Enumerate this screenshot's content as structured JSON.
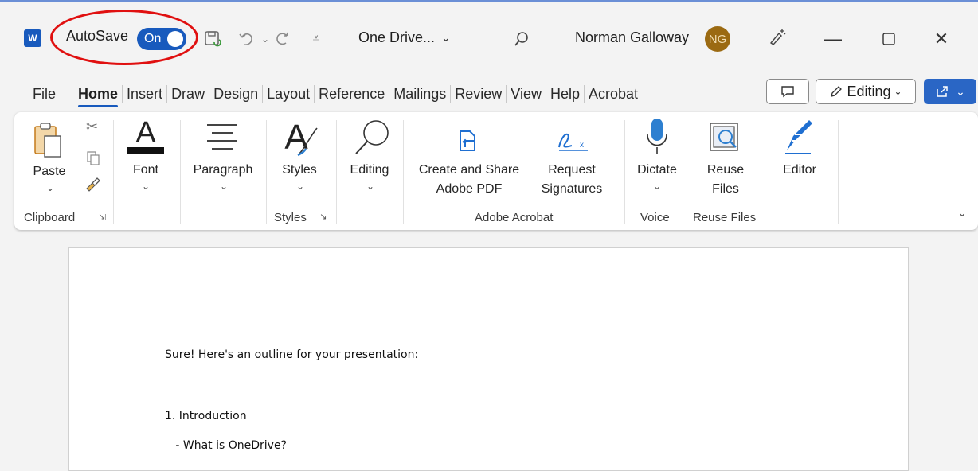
{
  "titlebar": {
    "app_icon_letter": "W",
    "autosave_label": "AutoSave",
    "autosave_state": "On",
    "file_location": "One Drive...",
    "user_name": "Norman Galloway",
    "user_initials": "NG"
  },
  "tabs": [
    "File",
    "Home",
    "Insert",
    "Draw",
    "Design",
    "Layout",
    "Reference",
    "Mailings",
    "Review",
    "View",
    "Help",
    "Acrobat"
  ],
  "active_tab": "Home",
  "mode_button_label": "Editing",
  "ribbon": {
    "paste": "Paste",
    "font": "Font",
    "paragraph": "Paragraph",
    "styles": "Styles",
    "editing": "Editing",
    "create_share_line1": "Create and Share",
    "create_share_line2": "Adobe PDF",
    "request_line1": "Request",
    "request_line2": "Signatures",
    "dictate": "Dictate",
    "reuse_line1": "Reuse",
    "reuse_line2": "Files",
    "editor": "Editor",
    "groups": {
      "clipboard": "Clipboard",
      "styles": "Styles",
      "adobe_acrobat": "Adobe Acrobat",
      "voice": "Voice",
      "reuse_files": "Reuse Files"
    }
  },
  "document": {
    "lines": [
      "Sure! Here's an outline for your presentation:",
      "1. Introduction",
      "   - What is OneDrive?"
    ]
  },
  "colors": {
    "accent": "#185abd",
    "highlight_ellipse": "#e01010",
    "avatar_bg": "#9b6a12"
  }
}
